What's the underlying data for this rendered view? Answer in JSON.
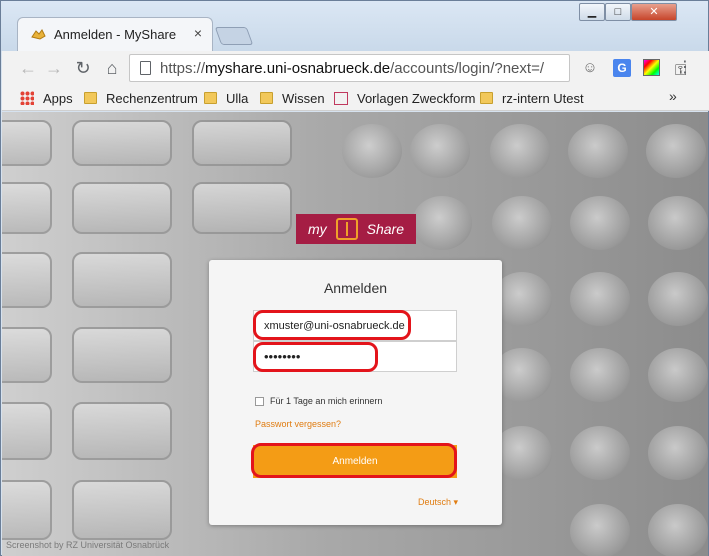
{
  "browser": {
    "tab_title": "Anmelden - MyShare",
    "tab_close": "×",
    "window_controls": {
      "minimize": "▁",
      "maximize": "□",
      "close": "✕"
    },
    "url_prefix": "https://",
    "url_host": "myshare.uni-osnabrueck.de",
    "url_path": "/accounts/login/?next=/",
    "icons": {
      "back": "←",
      "forward": "→",
      "reload": "↻",
      "home": "⌂",
      "key": "⚿",
      "ghost": "☺",
      "translate": "G",
      "menu": "⋮"
    }
  },
  "bookmarks": {
    "items": [
      {
        "label": "Apps",
        "icon": "apps-icon"
      },
      {
        "label": "Rechenzentrum",
        "icon": "folder-icon"
      },
      {
        "label": "Ulla",
        "icon": "folder-icon"
      },
      {
        "label": "Wissen",
        "icon": "folder-icon"
      },
      {
        "label": "Vorlagen Zweckform",
        "icon": "bookmark-page-icon"
      },
      {
        "label": "rz-intern Utest",
        "icon": "folder-icon"
      }
    ],
    "more": "»"
  },
  "page": {
    "logo_left": "my",
    "logo_right": "Share",
    "watermark": "Screenshot by RZ Universität Osnabrück",
    "login": {
      "title": "Anmelden",
      "email_value": "xmuster@uni-osnabrueck.de",
      "password_value": "••••••••",
      "remember_label": "Für 1 Tage an mich erinnern",
      "forgot_label": "Passwort vergessen?",
      "submit_label": "Anmelden",
      "language": "Deutsch ▾"
    }
  },
  "colors": {
    "brand": "#a51d44",
    "accent": "#f49c15",
    "highlight": "#e3141b",
    "link": "#e07d12"
  }
}
